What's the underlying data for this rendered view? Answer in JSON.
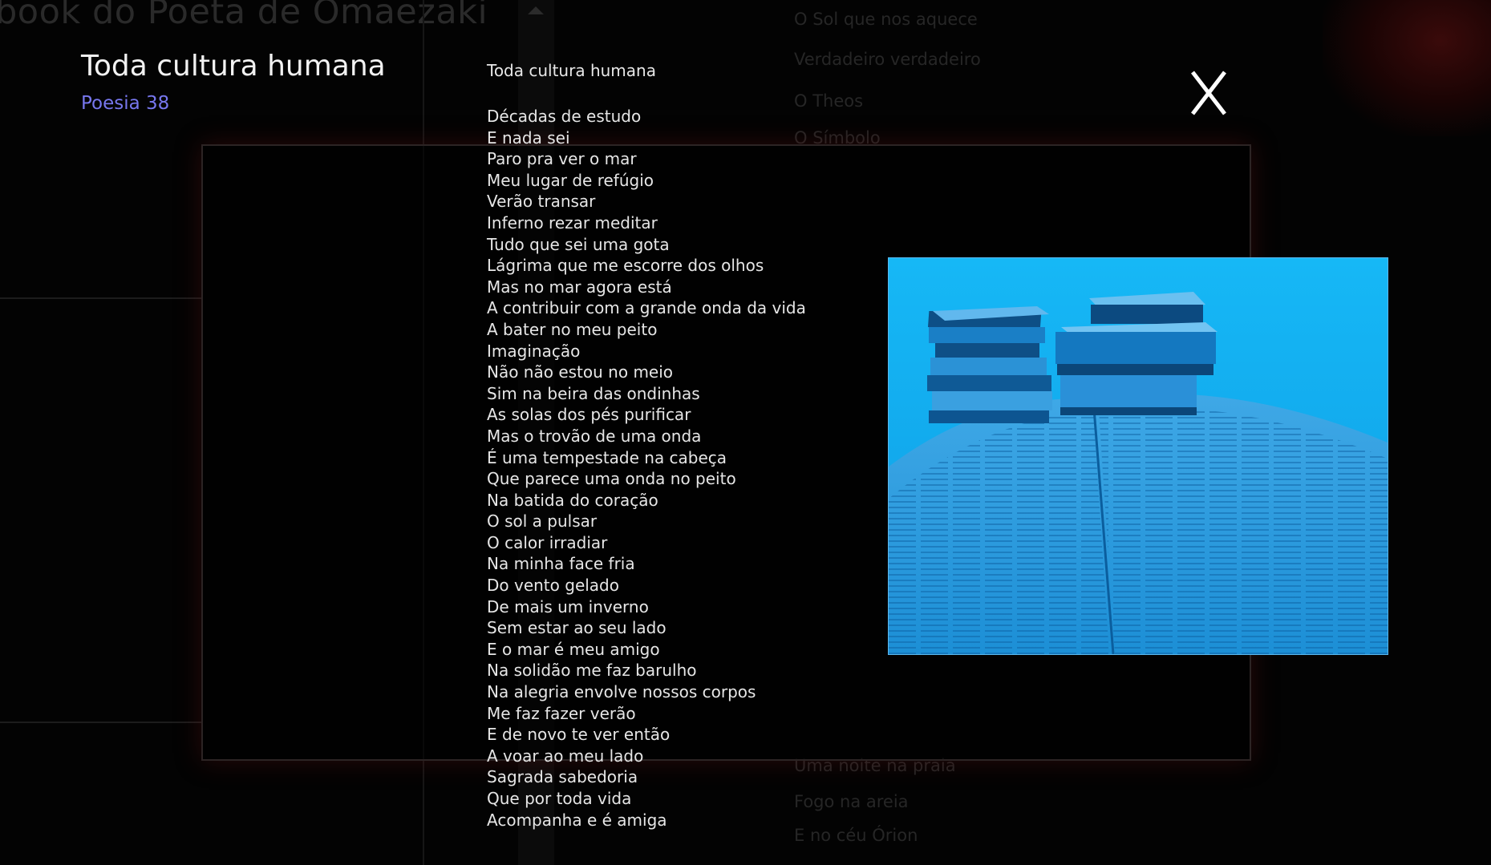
{
  "background": {
    "site_title": "book do Poeta de Omaezaki",
    "list_top": [
      "O Sol que nos aquece",
      "Verdadeiro  verdadeiro",
      "O Theos",
      "O Símbolo"
    ],
    "list_bottom": [
      "Uma noite na praia",
      "Fogo na areia",
      "E no céu Órion"
    ]
  },
  "poem": {
    "title": "Toda cultura humana",
    "number": "Poesia 38",
    "text_heading": "Toda cultura humana",
    "lines": [
      "Décadas de estudo",
      "E nada sei",
      "Paro pra ver o mar",
      "Meu lugar de refúgio",
      "Verão transar",
      "Inferno rezar meditar",
      "Tudo que sei uma gota",
      "Lágrima que me escorre dos olhos",
      "Mas no mar agora está",
      "A contribuir com a grande onda da vida",
      "A bater no meu peito",
      "Imaginação",
      "Não não estou no meio",
      "Sim na beira das ondinhas",
      "As solas dos pés purificar",
      "Mas o trovão de uma onda",
      "É uma tempestade na cabeça",
      "Que parece uma onda no peito",
      "Na batida do coração",
      "O sol a pulsar",
      "O calor irradiar",
      "Na minha face fria",
      "Do vento gelado",
      "De mais um inverno",
      "Sem estar ao seu lado",
      "E o mar é meu amigo",
      "Na solidão me faz barulho",
      "Na alegria envolve nossos corpos",
      "Me faz fazer verão",
      "E de novo te ver então",
      "A voar ao meu lado",
      "Sagrada sabedoria",
      "Que por toda vida",
      "Acompanha e é amiga"
    ]
  },
  "controls": {
    "close_label": "X"
  },
  "image": {
    "icon": "books-image",
    "tint": "#18b4f2"
  }
}
